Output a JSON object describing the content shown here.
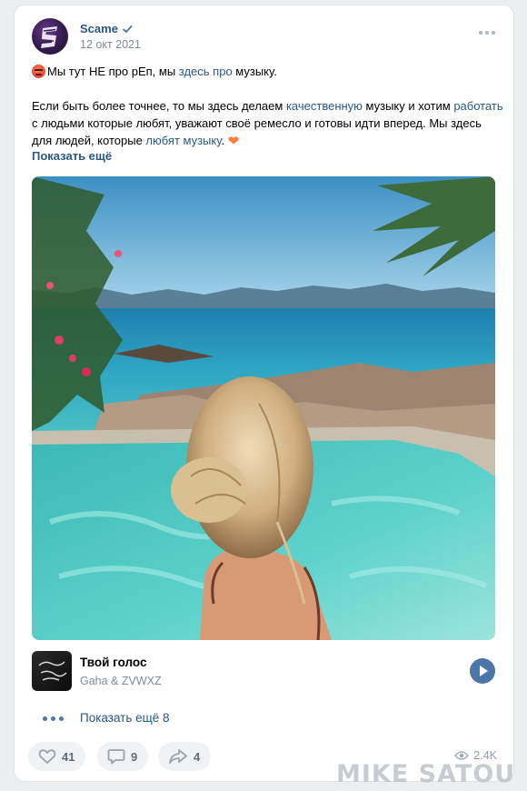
{
  "post": {
    "author": "Scame",
    "date": "12 окт 2021",
    "line1": {
      "t1": "Мы тут НЕ про рЕп, мы ",
      "link1": "здесь про",
      "t2": " музыку."
    },
    "line2": {
      "t1": "Если быть более точнее, то мы здесь делаем ",
      "link1": "качественную",
      "t2": " музыку и хотим ",
      "link2": "работать",
      "t3": " с людьми которые любят, уважают своё ремесло и готовы идти вперед. Мы здесь для людей, которые ",
      "link3": "любят музыку",
      "t4": "."
    },
    "show_more": "Показать ещё"
  },
  "audio": {
    "title": "Твой голос",
    "artist": "Gaha & ZVWXZ",
    "show_more": "Показать ещё 8"
  },
  "actions": {
    "likes": "41",
    "comments": "9",
    "shares": "4",
    "views": "2.4K"
  },
  "watermark": "MIKE SATOU",
  "colors": {
    "link": "#2a5885",
    "accent": "#4a76a8",
    "muted": "#818c99"
  },
  "icons": [
    "verified-icon",
    "more-icon",
    "angry-emoji-icon",
    "heart-emoji-icon",
    "play-icon",
    "like-icon",
    "comment-icon",
    "share-icon",
    "views-icon"
  ]
}
